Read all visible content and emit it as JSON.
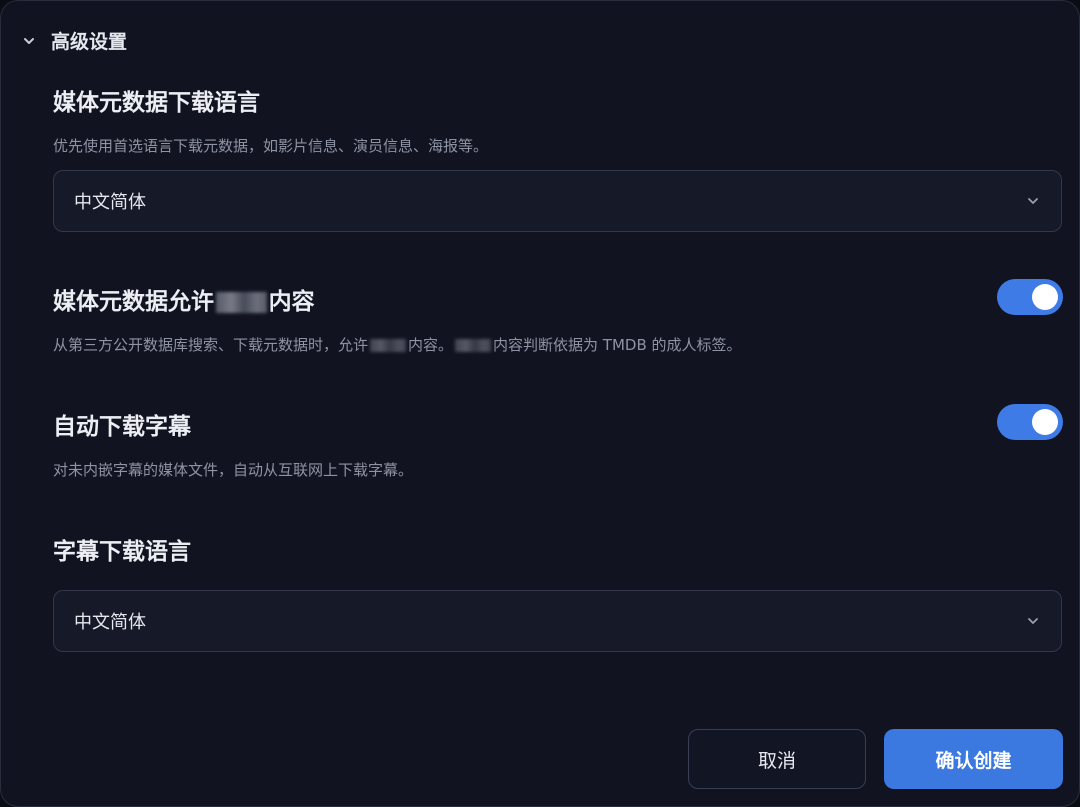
{
  "section": {
    "title": "高级设置",
    "expanded": true,
    "icon": "chevron-down-icon"
  },
  "metadata_language": {
    "label": "媒体元数据下载语言",
    "description": "优先使用首选语言下载元数据，如影片信息、演员信息、海报等。",
    "value": "中文简体"
  },
  "adult_content": {
    "label_before": "媒体元数据允许",
    "label_after": "内容",
    "description_part1": "从第三方公开数据库搜索、下载元数据时，允许",
    "description_part2": "内容。",
    "description_part3": "内容判断依据为 TMDB 的成人标签。",
    "enabled": true
  },
  "auto_subtitles": {
    "label": "自动下载字幕",
    "description": "对未内嵌字幕的媒体文件，自动从互联网上下载字幕。",
    "enabled": true
  },
  "subtitle_language": {
    "label": "字幕下载语言",
    "value": "中文简体"
  },
  "actions": {
    "cancel_label": "取消",
    "confirm_label": "确认创建"
  },
  "colors": {
    "accent": "#3b78df",
    "toggle_on": "#3f7be6",
    "background": "#111320"
  }
}
